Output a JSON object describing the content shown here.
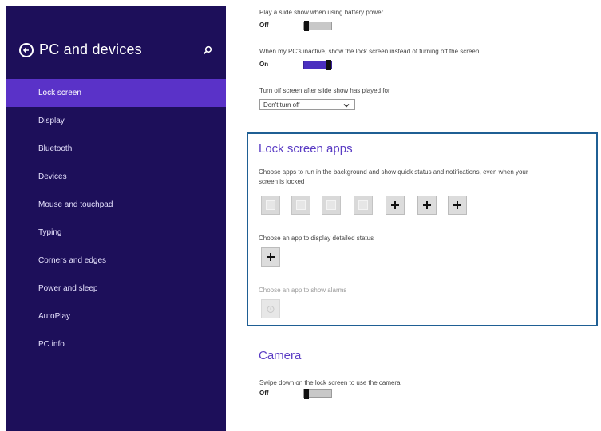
{
  "sidebar": {
    "title": "PC and devices",
    "items": [
      {
        "label": "Lock screen",
        "active": true
      },
      {
        "label": "Display",
        "active": false
      },
      {
        "label": "Bluetooth",
        "active": false
      },
      {
        "label": "Devices",
        "active": false
      },
      {
        "label": "Mouse and touchpad",
        "active": false
      },
      {
        "label": "Typing",
        "active": false
      },
      {
        "label": "Corners and edges",
        "active": false
      },
      {
        "label": "Power and sleep",
        "active": false
      },
      {
        "label": "AutoPlay",
        "active": false
      },
      {
        "label": "PC info",
        "active": false
      }
    ]
  },
  "slideshow": {
    "battery_label": "Play a slide show when using battery power",
    "battery_state": "Off",
    "inactive_label": "When my PC's inactive, show the lock screen instead of turning off the screen",
    "inactive_state": "On",
    "screen_off_label": "Turn off screen after slide show has played for",
    "screen_off_value": "Don't turn off"
  },
  "lock_apps": {
    "title": "Lock screen apps",
    "description_line1": "Choose apps to run in the background and show quick status and notifications, even when your",
    "description_line2": "screen is locked",
    "detailed_label": "Choose an app to display detailed status",
    "alarm_label": "Choose an app to show alarms"
  },
  "camera": {
    "title": "Camera",
    "swipe_label": "Swipe down on the lock screen to use the camera",
    "swipe_state": "Off"
  },
  "colors": {
    "sidebar_bg": "#1d0f5a",
    "sidebar_active": "#5a32c8",
    "accent": "#5a3cc4",
    "box_border": "#1f5f94"
  }
}
